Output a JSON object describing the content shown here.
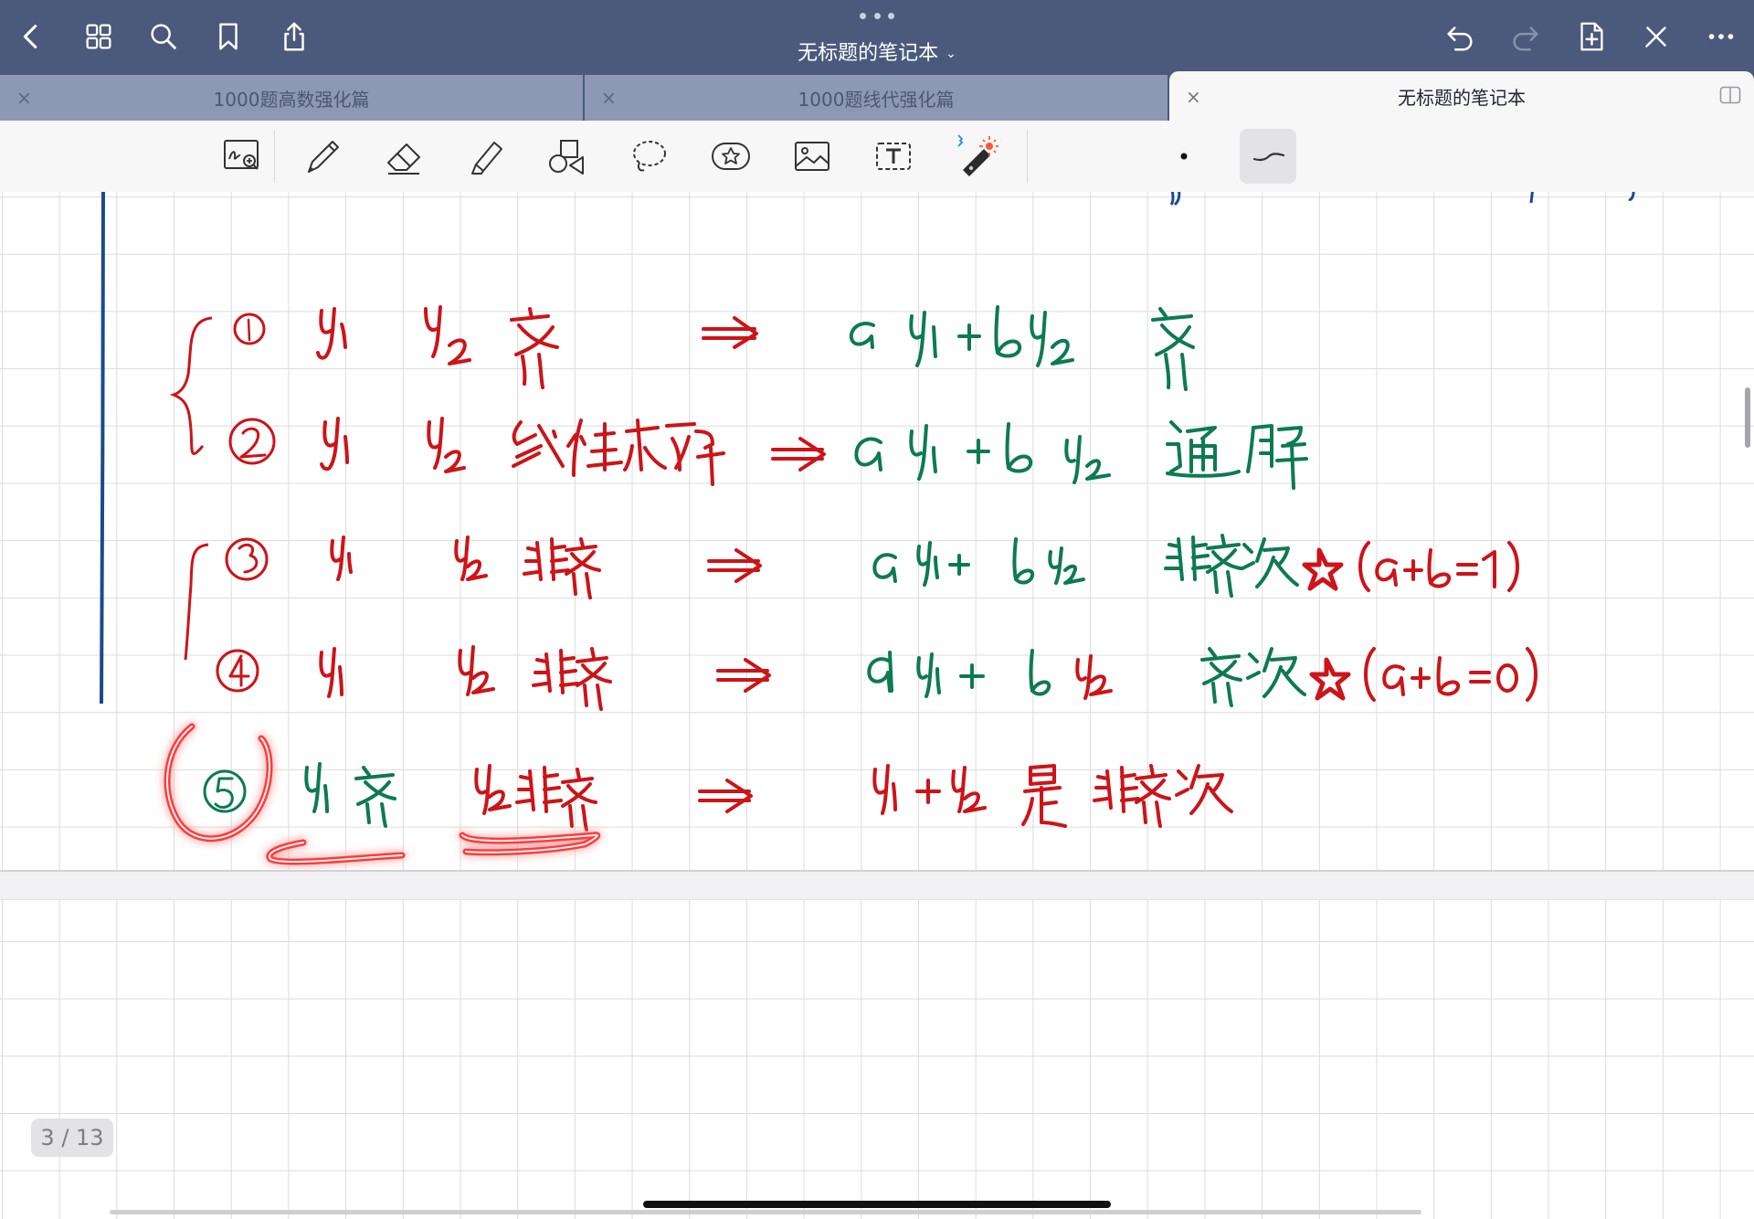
{
  "topbar": {
    "title": "无标题的笔记本",
    "title_chevron": "⌄"
  },
  "tabs": [
    {
      "label": "1000题高数强化篇",
      "close": "×"
    },
    {
      "label": "1000题线代强化篇",
      "close": "×"
    },
    {
      "label": "无标题的笔记本",
      "close": "×",
      "active": true
    }
  ],
  "toolbar": {
    "tools": [
      "handwriting-zoom",
      "pen",
      "eraser",
      "highlighter",
      "shapes",
      "lasso",
      "elements",
      "image",
      "text",
      "laser-pointer"
    ],
    "selected_stroke": "pen-stroke-style"
  },
  "colors": {
    "nav_bg": "#4b5a7c",
    "ink_red": "#cc1419",
    "ink_green": "#0d7a52",
    "ink_blue": "#1a4a8c"
  },
  "page_indicator": "3 / 13"
}
